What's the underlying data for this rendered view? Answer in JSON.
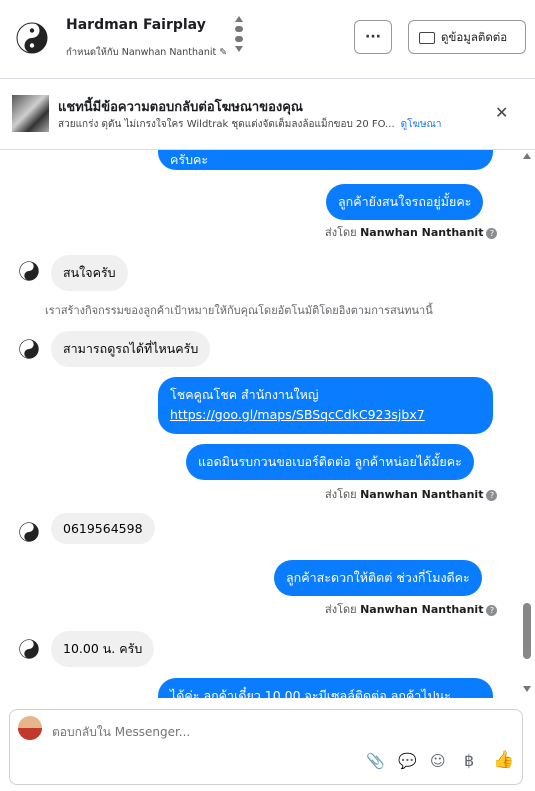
{
  "header": {
    "contact_name": "Hardman Fairplay",
    "assigned_label": "กำหนดให้กับ Nanwhan Nanthanit",
    "more_label": "···",
    "contact_info_label": "ดูข้อมูลติดต่อ"
  },
  "banner": {
    "title": "แชทนี้มีข้อความตอบกลับต่อโฆษณาของคุณ",
    "subtitle": "สวยแกร่ง ดุดัน ไม่เกรงใจใคร Wildtrak ชุดแต่งจัดเต็มลงล้อแม็กขอบ 20 FO...",
    "link": "ดูโฆษณา",
    "close": "✕"
  },
  "messages": {
    "m0": "ครับคะ",
    "m1": "ลูกค้ายังสนใจรถอยู่มั้ยคะ",
    "m2": "สนใจครับ",
    "m3": "สามารถดูรถได้ที่ไหนครับ",
    "m4_line1": "โชคคูณโชค สำนักงานใหญ่",
    "m4_link": "https://goo.gl/maps/SBSqcCdkC923sjbx7",
    "m5": "แอดมินรบกวนขอเบอร์ติดต่อ ลูกค้าหน่อยได้มั้ยคะ",
    "m6": "0619564598",
    "m7": "ลูกค้าสะดวกให้ติดต่ ช่วงกี่โมงดีคะ",
    "m8": "10.00 น. ครับ",
    "m9": "ได้ค่ะ ลูกค้าเดี๋ยว 10.00 จะมีเซลล์ติดต่อ ลูกค้าไปนะ"
  },
  "sent_by": {
    "prefix": "ส่งโดย",
    "agent": "Nanwhan Nanthanit",
    "help": "?"
  },
  "system_note": "เราสร้างกิจกรรมของลูกค้าเป้าหมายให้กับคุณโดยอัตโนมัติโดยอิงตามการสนทนานี้",
  "composer": {
    "placeholder": "ตอบกลับใน Messenger..."
  },
  "colors": {
    "outgoing": "#0a7cff",
    "incoming": "#f0f0f0",
    "link": "#1877f2"
  },
  "icons": [
    "yin-yang-icon",
    "pencil-icon",
    "info-card-icon",
    "close-icon",
    "attach-icon",
    "saved-reply-icon",
    "emoji-icon",
    "baht-icon",
    "like-icon"
  ]
}
